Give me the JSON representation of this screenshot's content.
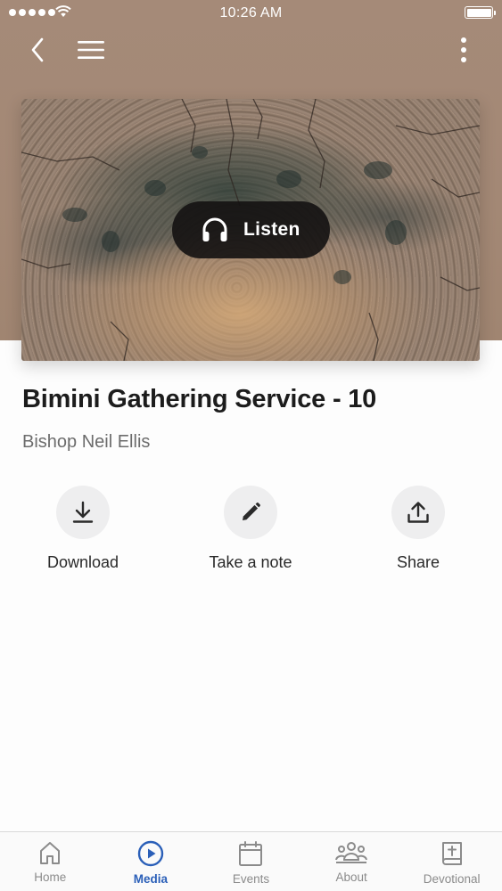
{
  "status_bar": {
    "time": "10:26 AM"
  },
  "nav": {
    "back_icon": "chevron-left-icon",
    "menu_icon": "hamburger-icon",
    "more_icon": "vertical-ellipsis-icon"
  },
  "media": {
    "listen_label": "Listen",
    "listen_icon": "headphones-icon",
    "title": "Bimini Gathering Service - 10",
    "speaker": "Bishop Neil Ellis"
  },
  "actions": [
    {
      "label": "Download",
      "icon": "download-icon"
    },
    {
      "label": "Take a note",
      "icon": "pencil-icon"
    },
    {
      "label": "Share",
      "icon": "share-icon"
    }
  ],
  "tabs": [
    {
      "label": "Home",
      "icon": "home-icon",
      "active": false
    },
    {
      "label": "Media",
      "icon": "play-circle-icon",
      "active": true
    },
    {
      "label": "Events",
      "icon": "calendar-icon",
      "active": false
    },
    {
      "label": "About",
      "icon": "people-icon",
      "active": false
    },
    {
      "label": "Devotional",
      "icon": "bible-icon",
      "active": false
    }
  ],
  "colors": {
    "header_bg": "#a58a78",
    "accent": "#2a5fb8",
    "tab_inactive": "#8b8b8b",
    "action_circle": "#eeeeef"
  }
}
